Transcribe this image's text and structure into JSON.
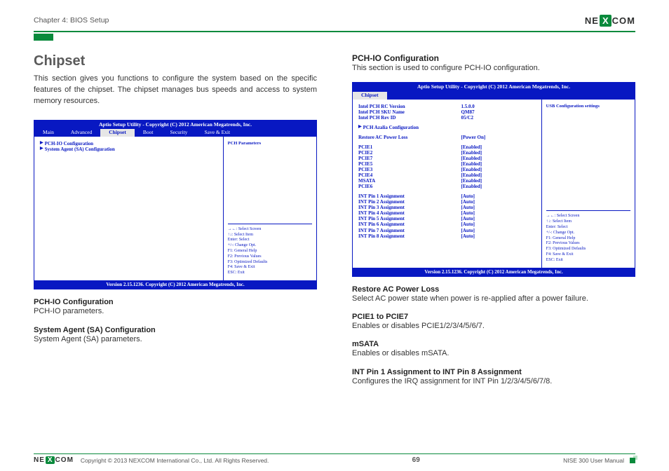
{
  "header": {
    "chapter": "Chapter 4: BIOS Setup",
    "logo_ne": "NE",
    "logo_x": "X",
    "logo_com": "COM"
  },
  "left": {
    "title": "Chipset",
    "intro": "This section gives you functions to configure the system based on the specific features of the chipset. The chipset manages bus speeds and access to system memory resources.",
    "bios": {
      "titlebar": "Aptio Setup Utility - Copyright (C) 2012 American Megatrends, Inc.",
      "menu": [
        "Main",
        "Advanced",
        "Chipset",
        "Boot",
        "Security",
        "Save & Exit"
      ],
      "active_tab": "Chipset",
      "left_items": [
        {
          "label": "PCH-IO Configuration",
          "value": "",
          "arrow": true
        },
        {
          "label": "System Agent (SA) Configuration",
          "value": "",
          "arrow": true
        }
      ],
      "right_hint": "PCH Parameters",
      "hints": [
        "→←: Select Screen",
        "↑↓: Select Item",
        "Enter: Select",
        "+/-: Change Opt.",
        "F1: General Help",
        "F2: Previous Values",
        "F3: Optimized Defaults",
        "F4: Save & Exit",
        "ESC: Exit"
      ],
      "footer": "Version 2.15.1236. Copyright (C) 2012 American Megatrends, Inc."
    },
    "items": [
      {
        "title": "PCH-IO Configuration",
        "desc": "PCH-IO parameters."
      },
      {
        "title": "System Agent (SA) Configuration",
        "desc": "System Agent (SA) parameters."
      }
    ]
  },
  "right": {
    "title": "PCH-IO Configuration",
    "intro": "This section is used to configure PCH-IO configuration.",
    "bios": {
      "titlebar": "Aptio Setup Utility - Copyright (C) 2012 American Megatrends, Inc.",
      "active_tab": "Chipset",
      "left_rows": [
        {
          "label": "Intel PCH RC Version",
          "value": "1.5.0.0"
        },
        {
          "label": "Intel PCH SKU Name",
          "value": "QM87"
        },
        {
          "label": "Intel PCH Rev ID",
          "value": "05/C2"
        },
        {
          "spacer": true
        },
        {
          "label": "PCH Azalia Configuration",
          "value": "",
          "arrow": true
        },
        {
          "spacer": true
        },
        {
          "label": "Restore AC Power Loss",
          "value": "[Power On]"
        },
        {
          "spacer": true
        },
        {
          "label": "PCIE1",
          "value": "[Enabled]"
        },
        {
          "label": "PCIE2",
          "value": "[Enabled]"
        },
        {
          "label": "PCIE7",
          "value": "[Enabled]"
        },
        {
          "label": "PCIE5",
          "value": "[Enabled]"
        },
        {
          "label": "PCIE3",
          "value": "[Enabled]"
        },
        {
          "label": "PCIE4",
          "value": "[Enabled]"
        },
        {
          "label": "MSATA",
          "value": "[Enabled]"
        },
        {
          "label": "PCIE6",
          "value": "[Enabled]"
        },
        {
          "spacer": true
        },
        {
          "label": "INT Pin 1 Assignment",
          "value": "[Auto]"
        },
        {
          "label": "INT Pin 2 Assignment",
          "value": "[Auto]"
        },
        {
          "label": "INT Pin 3 Assignment",
          "value": "[Auto]"
        },
        {
          "label": "INT Pin 4 Assignment",
          "value": "[Auto]"
        },
        {
          "label": "INT Pin 5 Assignment",
          "value": "[Auto]"
        },
        {
          "label": "INT Pin 6 Assignment",
          "value": "[Auto]"
        },
        {
          "label": "INT Pin 7 Assignment",
          "value": "[Auto]"
        },
        {
          "label": "INT Pin 8 Assignment",
          "value": "[Auto]"
        }
      ],
      "right_hint": "USB Configuration settings",
      "hints": [
        "→←: Select Screen",
        "↑↓: Select Item",
        "Enter: Select",
        "+/-: Change Opt.",
        "F1: General Help",
        "F2: Previous Values",
        "F3: Optimized Defaults",
        "F4: Save & Exit",
        "ESC: Exit"
      ],
      "footer": "Version 2.15.1236. Copyright (C) 2012 American Megatrends, Inc."
    },
    "items": [
      {
        "title": "Restore AC Power Loss",
        "desc": "Select AC power state when power is re-applied after a power failure."
      },
      {
        "title": "PCIE1 to PCIE7",
        "desc": "Enables or disables PCIE1/2/3/4/5/6/7."
      },
      {
        "title": "mSATA",
        "desc": "Enables or disables mSATA."
      },
      {
        "title": "INT Pin 1 Assignment to INT Pin 8 Assignment",
        "desc": "Configures the IRQ assignment for INT Pin 1/2/3/4/5/6/7/8."
      }
    ]
  },
  "footer": {
    "copyright": "Copyright © 2013 NEXCOM International Co., Ltd. All Rights Reserved.",
    "page": "69",
    "manual": "NISE 300 User Manual"
  }
}
